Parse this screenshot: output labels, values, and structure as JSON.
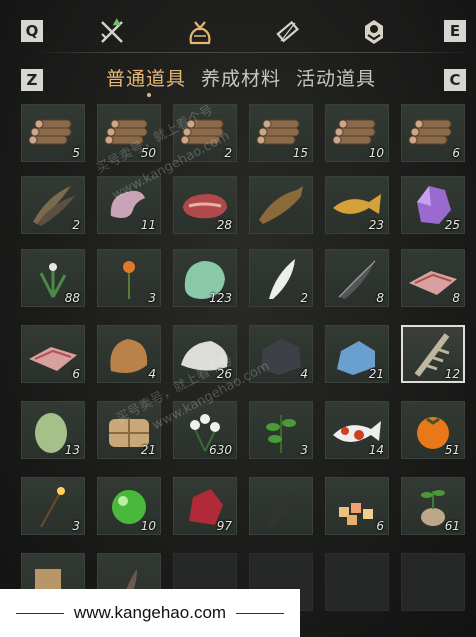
{
  "hotkeys": {
    "prev_category": "Q",
    "next_category": "E",
    "prev_tab": "Z",
    "next_tab": "C"
  },
  "categories": [
    {
      "icon": "crossed-swords-icon"
    },
    {
      "icon": "item-pouch-icon",
      "active": true
    },
    {
      "icon": "scroll-icon"
    },
    {
      "icon": "emblem-icon"
    }
  ],
  "tabs": [
    {
      "label": "普通道具",
      "active": true
    },
    {
      "label": "养成材料",
      "active": false
    },
    {
      "label": "活动道具",
      "active": false
    }
  ],
  "inventory": [
    {
      "icon": "wood-logs-icon",
      "count": "5"
    },
    {
      "icon": "wood-logs-icon",
      "count": "50"
    },
    {
      "icon": "wood-logs-icon",
      "count": "2"
    },
    {
      "icon": "wood-logs-icon",
      "count": "15"
    },
    {
      "icon": "wood-logs-icon",
      "count": "10"
    },
    {
      "icon": "wood-logs-icon",
      "count": "6"
    },
    {
      "icon": "feathers-icon",
      "count": "2"
    },
    {
      "icon": "raw-meat-pink-icon",
      "count": "11"
    },
    {
      "icon": "raw-steak-icon",
      "count": "28"
    },
    {
      "icon": "fish-icon",
      "count": ""
    },
    {
      "icon": "golden-carp-icon",
      "count": "23"
    },
    {
      "icon": "purple-crystal-icon",
      "count": "25"
    },
    {
      "icon": "herb-flower-icon",
      "count": "88"
    },
    {
      "icon": "orange-flower-icon",
      "count": "3"
    },
    {
      "icon": "jade-stone-icon",
      "count": "123"
    },
    {
      "icon": "white-feather-icon",
      "count": "2"
    },
    {
      "icon": "dark-feather-icon",
      "count": "8"
    },
    {
      "icon": "meat-slice-icon",
      "count": "8"
    },
    {
      "icon": "meat-slice-icon",
      "count": "6"
    },
    {
      "icon": "fur-pelt-icon",
      "count": "4"
    },
    {
      "icon": "white-fur-icon",
      "count": "26"
    },
    {
      "icon": "dark-ore-icon",
      "count": "4"
    },
    {
      "icon": "blue-ore-icon",
      "count": "21"
    },
    {
      "icon": "bone-icon",
      "count": "12",
      "selected": true
    },
    {
      "icon": "green-melon-icon",
      "count": "13"
    },
    {
      "icon": "cloth-bundle-icon",
      "count": "21"
    },
    {
      "icon": "white-flower-icon",
      "count": "630"
    },
    {
      "icon": "green-herb-icon",
      "count": "3"
    },
    {
      "icon": "koi-fish-icon",
      "count": "14"
    },
    {
      "icon": "persimmon-icon",
      "count": "51"
    },
    {
      "icon": "sparkler-icon",
      "count": "3"
    },
    {
      "icon": "green-orb-icon",
      "count": "10"
    },
    {
      "icon": "red-crystal-icon",
      "count": "97"
    },
    {
      "icon": "black-feather-icon",
      "count": ""
    },
    {
      "icon": "candy-pile-icon",
      "count": "6"
    },
    {
      "icon": "root-sprout-icon",
      "count": "61"
    },
    {
      "icon": "scroll-bundle-icon",
      "count": ""
    },
    {
      "icon": "feather-quill-icon",
      "count": ""
    },
    {
      "icon": "",
      "count": ""
    },
    {
      "icon": "",
      "count": ""
    },
    {
      "icon": "",
      "count": ""
    },
    {
      "icon": "",
      "count": ""
    }
  ],
  "watermarks": [
    "买号卖号，就上看个号",
    "www.kangehao.com"
  ],
  "banner": {
    "url": "www.kangehao.com"
  },
  "colors": {
    "accent": "#e4b873",
    "slot": "#2f352f",
    "background": "#1b1b1a"
  }
}
